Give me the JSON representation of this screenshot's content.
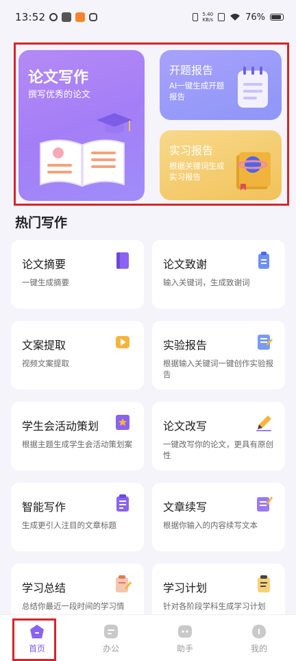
{
  "status_bar": {
    "time": "13:52",
    "speed_value": "5.40",
    "speed_unit": "KB/s",
    "battery": "76%"
  },
  "banner": {
    "main_card": {
      "title": "论文写作",
      "subtitle": "撰写优秀的论文"
    },
    "card_proposal": {
      "title": "开题报告",
      "desc": "AI一键生成开题报告"
    },
    "card_internship": {
      "title": "实习报告",
      "desc": "根据关键词生成实习报告"
    }
  },
  "hot_section": {
    "title": "热门写作"
  },
  "features": [
    {
      "title": "论文摘要",
      "desc": "一键生成摘要"
    },
    {
      "title": "论文致谢",
      "desc": "输入关键词，生成致谢词"
    },
    {
      "title": "文案提取",
      "desc": "视频文案提取"
    },
    {
      "title": "实验报告",
      "desc": "根据输入关键词一键创作实验报告"
    },
    {
      "title": "学生会活动策划",
      "desc": "根据主题生成学生会活动策划案"
    },
    {
      "title": "论文改写",
      "desc": "一键改写你的论文，更具有原创性"
    },
    {
      "title": "智能写作",
      "desc": "生成更引人注目的文章标题"
    },
    {
      "title": "文章续写",
      "desc": "根据你输入的内容续写文本"
    },
    {
      "title": "学习总结",
      "desc": "总结你最近一段时间的学习情"
    },
    {
      "title": "学习计划",
      "desc": "针对各阶段学科生成学习计划"
    }
  ],
  "bottom_nav": [
    {
      "label": "首页",
      "icon": "home-icon",
      "active": true
    },
    {
      "label": "办公",
      "icon": "office-icon",
      "active": false
    },
    {
      "label": "助手",
      "icon": "assistant-icon",
      "active": false
    },
    {
      "label": "我的",
      "icon": "profile-icon",
      "active": false
    }
  ],
  "colors": {
    "accent": "#7f5af0",
    "highlight_border": "#d8232a",
    "page_bg": "#f6f4fb"
  }
}
